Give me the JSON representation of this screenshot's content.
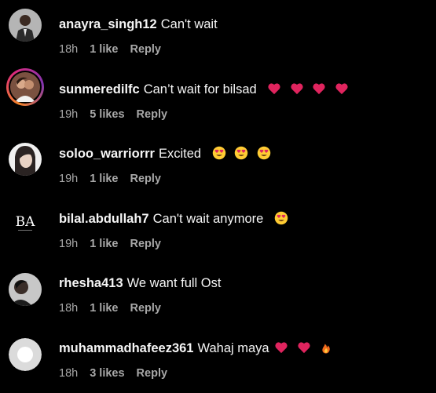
{
  "comments": [
    {
      "username": "anayra_singh12",
      "text": "Can't wait",
      "time": "18h",
      "likes": "1 like",
      "reply_label": "Reply",
      "emojis": []
    },
    {
      "username": "sunmeredilfc",
      "text": "Can’t wait for bilsad",
      "time": "19h",
      "likes": "5 likes",
      "reply_label": "Reply",
      "emojis": [
        "red-heart",
        "red-heart",
        "red-heart",
        "red-heart"
      ]
    },
    {
      "username": "soloo_warriorrr",
      "text": "Excited",
      "time": "19h",
      "likes": "1 like",
      "reply_label": "Reply",
      "emojis": [
        "heart-eyes",
        "heart-eyes",
        "heart-eyes"
      ]
    },
    {
      "username": "bilal.abdullah7",
      "text": "Can't wait anymore",
      "time": "19h",
      "likes": "1 like",
      "reply_label": "Reply",
      "avatar_monogram": "BA",
      "emojis": [
        "heart-eyes"
      ]
    },
    {
      "username": "rhesha413",
      "text": "We want full Ost",
      "time": "18h",
      "likes": "1 like",
      "reply_label": "Reply",
      "emojis": []
    },
    {
      "username": "muhammadhafeez361",
      "text": "Wahaj maya",
      "time": "18h",
      "likes": "3 likes",
      "reply_label": "Reply",
      "emojis": [
        "red-heart",
        "red-heart",
        "fire"
      ]
    }
  ],
  "colors": {
    "background": "#000000",
    "text": "#f5f5f5",
    "meta": "#a8a8a8",
    "heart": "#e0245e",
    "emoji_face": "#ffcc33"
  }
}
